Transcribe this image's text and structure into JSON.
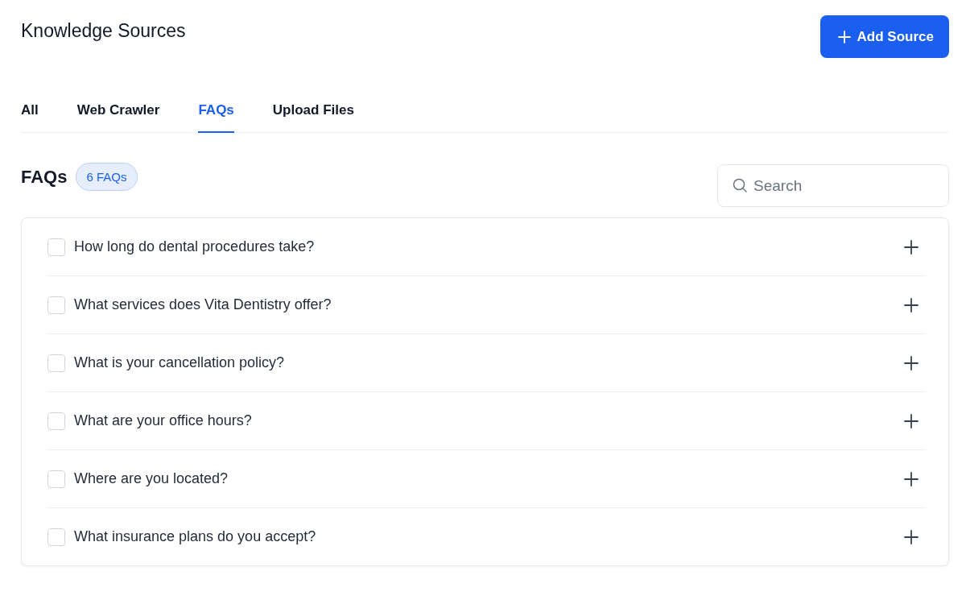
{
  "header": {
    "title": "Knowledge Sources",
    "add_button": "Add Source"
  },
  "tabs": [
    {
      "label": "All",
      "selected": false
    },
    {
      "label": "Web Crawler",
      "selected": false
    },
    {
      "label": "FAQs",
      "selected": true
    },
    {
      "label": "Upload Files",
      "selected": false
    }
  ],
  "section": {
    "title": "FAQs",
    "count_badge": "6 FAQs"
  },
  "search": {
    "placeholder": "Search"
  },
  "faqs": [
    {
      "question": "How long do dental procedures take?",
      "checked": false,
      "expanded": false
    },
    {
      "question": "What services does Vita Dentistry offer?",
      "checked": false,
      "expanded": false
    },
    {
      "question": "What is your cancellation policy?",
      "checked": false,
      "expanded": false
    },
    {
      "question": "What are your office hours?",
      "checked": false,
      "expanded": false
    },
    {
      "question": "Where are you located?",
      "checked": false,
      "expanded": false
    },
    {
      "question": "What insurance plans do you accept?",
      "checked": false,
      "expanded": false
    }
  ]
}
